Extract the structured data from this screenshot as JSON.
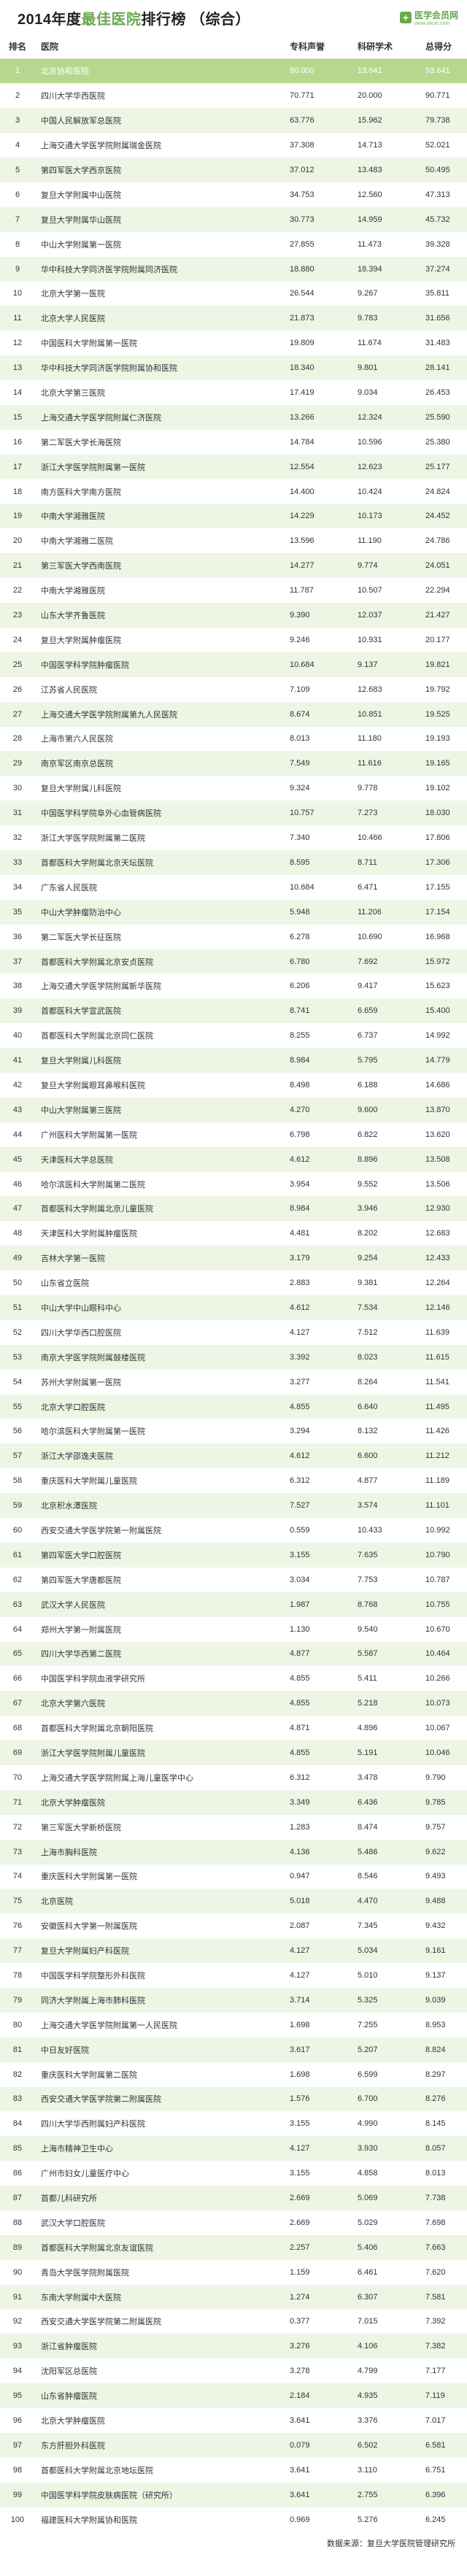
{
  "header": {
    "title_prefix": "2014年度",
    "title_highlight": "最佳医院",
    "title_suffix": "排行榜 （综合）",
    "logo_text": "医学会员网",
    "logo_sub": "www.yixue.com",
    "logo_mark": "+"
  },
  "table": {
    "columns": [
      "排名",
      "医院",
      "专科声誉",
      "科研学术",
      "总得分"
    ],
    "rows": [
      [
        "1",
        "北京协和医院",
        "80.000",
        "13.641",
        "93.641"
      ],
      [
        "2",
        "四川大学华西医院",
        "70.771",
        "20.000",
        "90.771"
      ],
      [
        "3",
        "中国人民解放军总医院",
        "63.776",
        "15.962",
        "79.738"
      ],
      [
        "4",
        "上海交通大学医学院附属瑞金医院",
        "37.308",
        "14.713",
        "52.021"
      ],
      [
        "5",
        "第四军医大学西京医院",
        "37.012",
        "13.483",
        "50.495"
      ],
      [
        "6",
        "复旦大学附属中山医院",
        "34.753",
        "12.560",
        "47.313"
      ],
      [
        "7",
        "复旦大学附属华山医院",
        "30.773",
        "14.959",
        "45.732"
      ],
      [
        "8",
        "中山大学附属第一医院",
        "27.855",
        "11.473",
        "39.328"
      ],
      [
        "9",
        "华中科技大学同济医学院附属同济医院",
        "18.880",
        "18.394",
        "37.274"
      ],
      [
        "10",
        "北京大学第一医院",
        "26.544",
        "9.267",
        "35.811"
      ],
      [
        "11",
        "北京大学人民医院",
        "21.873",
        "9.783",
        "31.656"
      ],
      [
        "12",
        "中国医科大学附属第一医院",
        "19.809",
        "11.674",
        "31.483"
      ],
      [
        "13",
        "华中科技大学同济医学院附属协和医院",
        "18.340",
        "9.801",
        "28.141"
      ],
      [
        "14",
        "北京大学第三医院",
        "17.419",
        "9.034",
        "26.453"
      ],
      [
        "15",
        "上海交通大学医学院附属仁济医院",
        "13.266",
        "12.324",
        "25.590"
      ],
      [
        "16",
        "第二军医大学长海医院",
        "14.784",
        "10.596",
        "25.380"
      ],
      [
        "17",
        "浙江大学医学院附属第一医院",
        "12.554",
        "12.623",
        "25.177"
      ],
      [
        "18",
        "南方医科大学南方医院",
        "14.400",
        "10.424",
        "24.824"
      ],
      [
        "19",
        "中南大学湘雅医院",
        "14.229",
        "10.173",
        "24.452"
      ],
      [
        "20",
        "中南大学湘雅二医院",
        "13.596",
        "11.190",
        "24.786"
      ],
      [
        "21",
        "第三军医大学西南医院",
        "14.277",
        "9.774",
        "24.051"
      ],
      [
        "22",
        "中南大学湘雅医院",
        "11.787",
        "10.507",
        "22.294"
      ],
      [
        "23",
        "山东大学齐鲁医院",
        "9.390",
        "12.037",
        "21.427"
      ],
      [
        "24",
        "复旦大学附属肿瘤医院",
        "9.246",
        "10.931",
        "20.177"
      ],
      [
        "25",
        "中国医学科学院肿瘤医院",
        "10.684",
        "9.137",
        "19.821"
      ],
      [
        "26",
        "江苏省人民医院",
        "7.109",
        "12.683",
        "19.792"
      ],
      [
        "27",
        "上海交通大学医学院附属第九人民医院",
        "8.674",
        "10.851",
        "19.525"
      ],
      [
        "28",
        "上海市第六人民医院",
        "8.013",
        "11.180",
        "19.193"
      ],
      [
        "29",
        "南京军区南京总医院",
        "7.549",
        "11.616",
        "19.165"
      ],
      [
        "30",
        "复旦大学附属儿科医院",
        "9.324",
        "9.778",
        "19.102"
      ],
      [
        "31",
        "中国医学科学院阜外心血管病医院",
        "10.757",
        "7.273",
        "18.030"
      ],
      [
        "32",
        "浙江大学医学院附属第二医院",
        "7.340",
        "10.466",
        "17.806"
      ],
      [
        "33",
        "首都医科大学附属北京天坛医院",
        "8.595",
        "8.711",
        "17.306"
      ],
      [
        "34",
        "广东省人民医院",
        "10.684",
        "6.471",
        "17.155"
      ],
      [
        "35",
        "中山大学肿瘤防治中心",
        "5.948",
        "11.206",
        "17.154"
      ],
      [
        "36",
        "第二军医大学长征医院",
        "6.278",
        "10.690",
        "16.968"
      ],
      [
        "37",
        "首都医科大学附属北京安贞医院",
        "6.780",
        "7.692",
        "15.972"
      ],
      [
        "38",
        "上海交通大学医学院附属新华医院",
        "6.206",
        "9.417",
        "15.623"
      ],
      [
        "39",
        "首都医科大学宣武医院",
        "8.741",
        "6.659",
        "15.400"
      ],
      [
        "40",
        "首都医科大学附属北京同仁医院",
        "8.255",
        "6.737",
        "14.992"
      ],
      [
        "41",
        "复旦大学附属儿科医院",
        "8.984",
        "5.795",
        "14.779"
      ],
      [
        "42",
        "复旦大学附属眼耳鼻喉科医院",
        "8.498",
        "6.188",
        "14.686"
      ],
      [
        "43",
        "中山大学附属第三医院",
        "4.270",
        "9.600",
        "13.870"
      ],
      [
        "44",
        "广州医科大学附属第一医院",
        "6.798",
        "6.822",
        "13.620"
      ],
      [
        "45",
        "天津医科大学总医院",
        "4.612",
        "8.896",
        "13.508"
      ],
      [
        "46",
        "哈尔滨医科大学附属第二医院",
        "3.954",
        "9.552",
        "13.506"
      ],
      [
        "47",
        "首都医科大学附属北京儿童医院",
        "8.984",
        "3.946",
        "12.930"
      ],
      [
        "48",
        "天津医科大学附属肿瘤医院",
        "4.481",
        "8.202",
        "12.683"
      ],
      [
        "49",
        "吉林大学第一医院",
        "3.179",
        "9.254",
        "12.433"
      ],
      [
        "50",
        "山东省立医院",
        "2.883",
        "9.381",
        "12.264"
      ],
      [
        "51",
        "中山大学中山眼科中心",
        "4.612",
        "7.534",
        "12.146"
      ],
      [
        "52",
        "四川大学华西口腔医院",
        "4.127",
        "7.512",
        "11.639"
      ],
      [
        "53",
        "南京大学医学院附属鼓楼医院",
        "3.392",
        "8.023",
        "11.615"
      ],
      [
        "54",
        "苏州大学附属第一医院",
        "3.277",
        "8.264",
        "11.541"
      ],
      [
        "55",
        "北京大学口腔医院",
        "4.855",
        "6.640",
        "11.495"
      ],
      [
        "56",
        "哈尔滨医科大学附属第一医院",
        "3.294",
        "8.132",
        "11.426"
      ],
      [
        "57",
        "浙江大学邵逸夫医院",
        "4.612",
        "6.600",
        "11.212"
      ],
      [
        "58",
        "重庆医科大学附属儿童医院",
        "6.312",
        "4.877",
        "11.189"
      ],
      [
        "59",
        "北京积水潭医院",
        "7.527",
        "3.574",
        "11.101"
      ],
      [
        "60",
        "西安交通大学医学院第一附属医院",
        "0.559",
        "10.433",
        "10.992"
      ],
      [
        "61",
        "第四军医大学口腔医院",
        "3.155",
        "7.635",
        "10.790"
      ],
      [
        "62",
        "第四军医大学唐都医院",
        "3.034",
        "7.753",
        "10.787"
      ],
      [
        "63",
        "武汉大学人民医院",
        "1.987",
        "8.768",
        "10.755"
      ],
      [
        "64",
        "郑州大学第一附属医院",
        "1.130",
        "9.540",
        "10.670"
      ],
      [
        "65",
        "四川大学华西第二医院",
        "4.877",
        "5.587",
        "10.464"
      ],
      [
        "66",
        "中国医学科学院血液学研究所",
        "4.855",
        "5.411",
        "10.266"
      ],
      [
        "67",
        "北京大学第六医院",
        "4.855",
        "5.218",
        "10.073"
      ],
      [
        "68",
        "首都医科大学附属北京朝阳医院",
        "4.871",
        "4.896",
        "10.067"
      ],
      [
        "69",
        "浙江大学医学院附属儿童医院",
        "4.855",
        "5.191",
        "10.046"
      ],
      [
        "70",
        "上海交通大学医学院附属上海儿童医学中心",
        "6.312",
        "3.478",
        "9.790"
      ],
      [
        "71",
        "北京大学肿瘤医院",
        "3.349",
        "6.436",
        "9.785"
      ],
      [
        "72",
        "第三军医大学新桥医院",
        "1.283",
        "8.474",
        "9.757"
      ],
      [
        "73",
        "上海市胸科医院",
        "4.136",
        "5.486",
        "9.622"
      ],
      [
        "74",
        "重庆医科大学附属第一医院",
        "0.947",
        "8.546",
        "9.493"
      ],
      [
        "75",
        "北京医院",
        "5.018",
        "4.470",
        "9.488"
      ],
      [
        "76",
        "安徽医科大学第一附属医院",
        "2.087",
        "7.345",
        "9.432"
      ],
      [
        "77",
        "复旦大学附属妇产科医院",
        "4.127",
        "5.034",
        "9.161"
      ],
      [
        "78",
        "中国医学科学院整形外科医院",
        "4.127",
        "5.010",
        "9.137"
      ],
      [
        "79",
        "同济大学附属上海市肺科医院",
        "3.714",
        "5.325",
        "9.039"
      ],
      [
        "80",
        "上海交通大学医学院附属第一人民医院",
        "1.698",
        "7.255",
        "8.953"
      ],
      [
        "81",
        "中日友好医院",
        "3.617",
        "5.207",
        "8.824"
      ],
      [
        "82",
        "重庆医科大学附属第二医院",
        "1.698",
        "6.599",
        "8.297"
      ],
      [
        "83",
        "西安交通大学医学院第二附属医院",
        "1.576",
        "6.700",
        "8.276"
      ],
      [
        "84",
        "四川大学华西附属妇产科医院",
        "3.155",
        "4.990",
        "8.145"
      ],
      [
        "85",
        "上海市精神卫生中心",
        "4.127",
        "3.930",
        "8.057"
      ],
      [
        "86",
        "广州市妇女儿童医疗中心",
        "3.155",
        "4.858",
        "8.013"
      ],
      [
        "87",
        "首都儿科研究所",
        "2.669",
        "5.069",
        "7.738"
      ],
      [
        "88",
        "武汉大学口腔医院",
        "2.669",
        "5.029",
        "7.698"
      ],
      [
        "89",
        "首都医科大学附属北京友谊医院",
        "2.257",
        "5.406",
        "7.663"
      ],
      [
        "90",
        "青岛大学医学院附属医院",
        "1.159",
        "6.461",
        "7.620"
      ],
      [
        "91",
        "东南大学附属中大医院",
        "1.274",
        "6.307",
        "7.581"
      ],
      [
        "92",
        "西安交通大学医学院第二附属医院",
        "0.377",
        "7.015",
        "7.392"
      ],
      [
        "93",
        "浙江省肿瘤医院",
        "3.276",
        "4.106",
        "7.382"
      ],
      [
        "94",
        "沈阳军区总医院",
        "3.278",
        "4.799",
        "7.177"
      ],
      [
        "95",
        "山东省肿瘤医院",
        "2.184",
        "4.935",
        "7.119"
      ],
      [
        "96",
        "北京大学肿瘤医院",
        "3.641",
        "3.376",
        "7.017"
      ],
      [
        "97",
        "东方肝胆外科医院",
        "0.079",
        "6.502",
        "6.581"
      ],
      [
        "98",
        "首都医科大学附属北京地坛医院",
        "3.641",
        "3.110",
        "6.751"
      ],
      [
        "99",
        "中国医学科学院皮肤病医院（研究所）",
        "3.641",
        "2.755",
        "6.396"
      ],
      [
        "100",
        "福建医科大学附属协和医院",
        "0.969",
        "5.276",
        "6.245"
      ]
    ]
  },
  "footer": {
    "label": "数据来源：",
    "source": "复旦大学医院管理研究所"
  }
}
